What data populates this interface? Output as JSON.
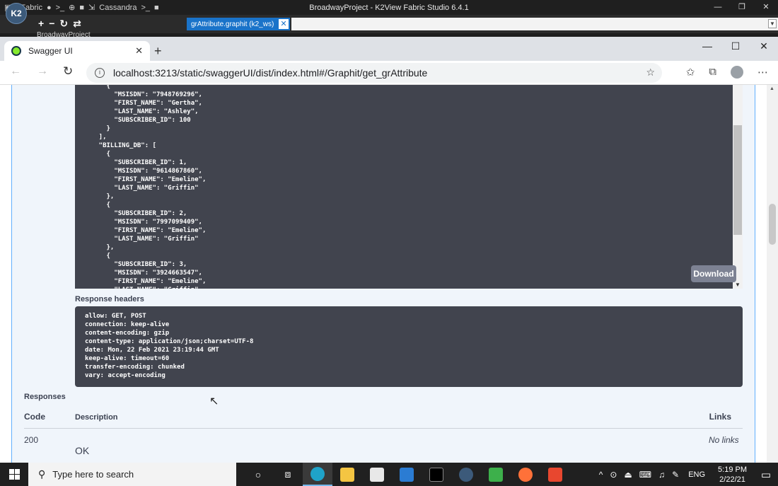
{
  "studio": {
    "title": "BroadwayProject - K2View Fabric Studio 6.4.1",
    "menu_fabric": "Fabric",
    "menu_cassandra": "Cassandra",
    "project": "BroadwayProject",
    "logo_text": "K2",
    "tab_label": "grAttribute.graphit (k2_ws)"
  },
  "browser": {
    "tab_title": "Swagger UI",
    "url": "localhost:3213/static/swaggerUI/dist/index.html#/Graphit/get_grAttribute"
  },
  "response_body": {
    "lines": [
      "      {",
      "        \"MSISDN\": \"7948769296\",",
      "        \"FIRST_NAME\": \"Gertha\",",
      "        \"LAST_NAME\": \"Ashley\",",
      "        \"SUBSCRIBER_ID\": 100",
      "      }",
      "    ],",
      "    \"BILLING_DB\": [",
      "      {",
      "        \"SUBSCRIBER_ID\": 1,",
      "        \"MSISDN\": \"9614867860\",",
      "        \"FIRST_NAME\": \"Emeline\",",
      "        \"LAST_NAME\": \"Griffin\"",
      "      },",
      "      {",
      "        \"SUBSCRIBER_ID\": 2,",
      "        \"MSISDN\": \"7997099409\",",
      "        \"FIRST_NAME\": \"Emeline\",",
      "        \"LAST_NAME\": \"Griffin\"",
      "      },",
      "      {",
      "        \"SUBSCRIBER_ID\": 3,",
      "        \"MSISDN\": \"3924663547\",",
      "        \"FIRST_NAME\": \"Emeline\",",
      "        \"LAST_NAME\": \"Griffin\""
    ],
    "download_label": "Download"
  },
  "response_headers": {
    "title": "Response headers",
    "lines": [
      "allow: GET, POST",
      "connection: keep-alive",
      "content-encoding: gzip",
      "content-type: application/json;charset=UTF-8",
      "date: Mon, 22 Feb 2021 23:19:44 GMT",
      "keep-alive: timeout=60",
      "transfer-encoding: chunked",
      "vary: accept-encoding"
    ]
  },
  "responses": {
    "title": "Responses",
    "col_code": "Code",
    "col_description": "Description",
    "col_links": "Links",
    "row": {
      "code": "200",
      "description": "OK",
      "links": "No links"
    }
  },
  "taskbar": {
    "search_placeholder": "Type here to search",
    "lang": "ENG",
    "time": "5:19 PM",
    "date": "2/22/21"
  },
  "colors": {
    "swagger_bg": "#f0f5fb",
    "code_bg": "#41444e",
    "studio_tab": "#1a73c9"
  }
}
